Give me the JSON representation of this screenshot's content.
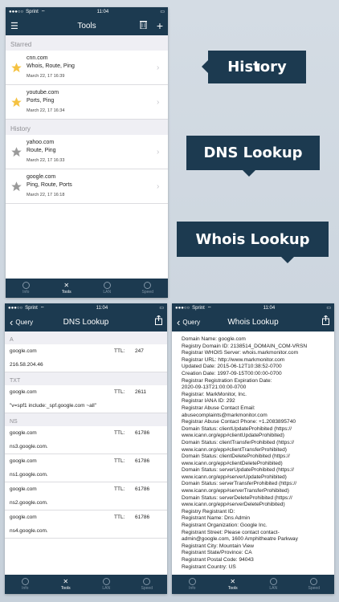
{
  "status": {
    "carrier": "Sprint",
    "time": "11:04"
  },
  "callouts": {
    "history": "History",
    "dns": "DNS Lookup",
    "whois": "Whois Lookup"
  },
  "tools_screen": {
    "title": "Tools",
    "sections": [
      {
        "header": "Starred",
        "items": [
          {
            "host": "cnn.com",
            "tools": "Whois, Route, Ping",
            "date": "March 22, 17 16:39",
            "starred": true
          },
          {
            "host": "youtube.com",
            "tools": "Ports, Ping",
            "date": "March 22, 17 16:34",
            "starred": true
          }
        ]
      },
      {
        "header": "History",
        "items": [
          {
            "host": "yahoo.com",
            "tools": "Route, Ping",
            "date": "March 22, 17 16:33",
            "starred": false
          },
          {
            "host": "google.com",
            "tools": "Ping, Route, Ports",
            "date": "March 22, 17 16:18",
            "starred": false
          }
        ]
      }
    ]
  },
  "tabs": [
    "Info",
    "Tools",
    "LAN",
    "Speed"
  ],
  "dns_screen": {
    "back": "Query",
    "title": "DNS Lookup",
    "sections": [
      {
        "header": "A",
        "records": [
          {
            "name": "google.com",
            "ttl_label": "TTL:",
            "ttl": "247",
            "value": "216.58.204.46"
          }
        ]
      },
      {
        "header": "TXT",
        "records": [
          {
            "name": "google.com",
            "ttl_label": "TTL:",
            "ttl": "2611",
            "value": "\"v=spf1 include:_spf.google.com ~all\""
          }
        ]
      },
      {
        "header": "NS",
        "records": [
          {
            "name": "google.com",
            "ttl_label": "TTL:",
            "ttl": "61786",
            "value": "ns3.google.com."
          },
          {
            "name": "google.com",
            "ttl_label": "TTL:",
            "ttl": "61786",
            "value": "ns1.google.com."
          },
          {
            "name": "google.com",
            "ttl_label": "TTL:",
            "ttl": "61786",
            "value": "ns2.google.com."
          },
          {
            "name": "google.com",
            "ttl_label": "TTL:",
            "ttl": "61786",
            "value": "ns4.google.com."
          }
        ]
      }
    ]
  },
  "whois_screen": {
    "back": "Query",
    "title": "Whois Lookup",
    "text": "Domain Name: google.com\nRegistry Domain ID: 2138514_DOMAIN_COM-VRSN\nRegistrar WHOIS Server: whois.markmonitor.com\nRegistrar URL: http://www.markmonitor.com\nUpdated Date: 2015-06-12T10:38:52-0700\nCreation Date: 1997-09-15T00:00:00-0700\nRegistrar Registration Expiration Date:\n2020-09-13T21:00:00-0700\nRegistrar: MarkMonitor, Inc.\nRegistrar IANA ID: 292\nRegistrar Abuse Contact Email:\nabusecomplaints@markmonitor.com\nRegistrar Abuse Contact Phone: +1.2083895740\nDomain Status: clientUpdateProhibited (https://\nwww.icann.org/epp#clientUpdateProhibited)\nDomain Status: clientTransferProhibited (https://\nwww.icann.org/epp#clientTransferProhibited)\nDomain Status: clientDeleteProhibited (https://\nwww.icann.org/epp#clientDeleteProhibited)\nDomain Status: serverUpdateProhibited (https://\nwww.icann.org/epp#serverUpdateProhibited)\nDomain Status: serverTransferProhibited (https://\nwww.icann.org/epp#serverTransferProhibited)\nDomain Status: serverDeleteProhibited (https://\nwww.icann.org/epp#serverDeleteProhibited)\nRegistry Registrant ID:\nRegistrant Name: Dns Admin\nRegistrant Organization: Google Inc.\nRegistrant Street: Please contact contact-\nadmin@google.com, 1600 Amphitheatre Parkway\nRegistrant City: Mountain View\nRegistrant State/Province: CA\nRegistrant Postal Code: 94043\nRegistrant Country: US"
  },
  "colors": {
    "navbar": "#1c3a50",
    "star_active": "#f5c242",
    "star_inactive": "#9a9a9a"
  }
}
